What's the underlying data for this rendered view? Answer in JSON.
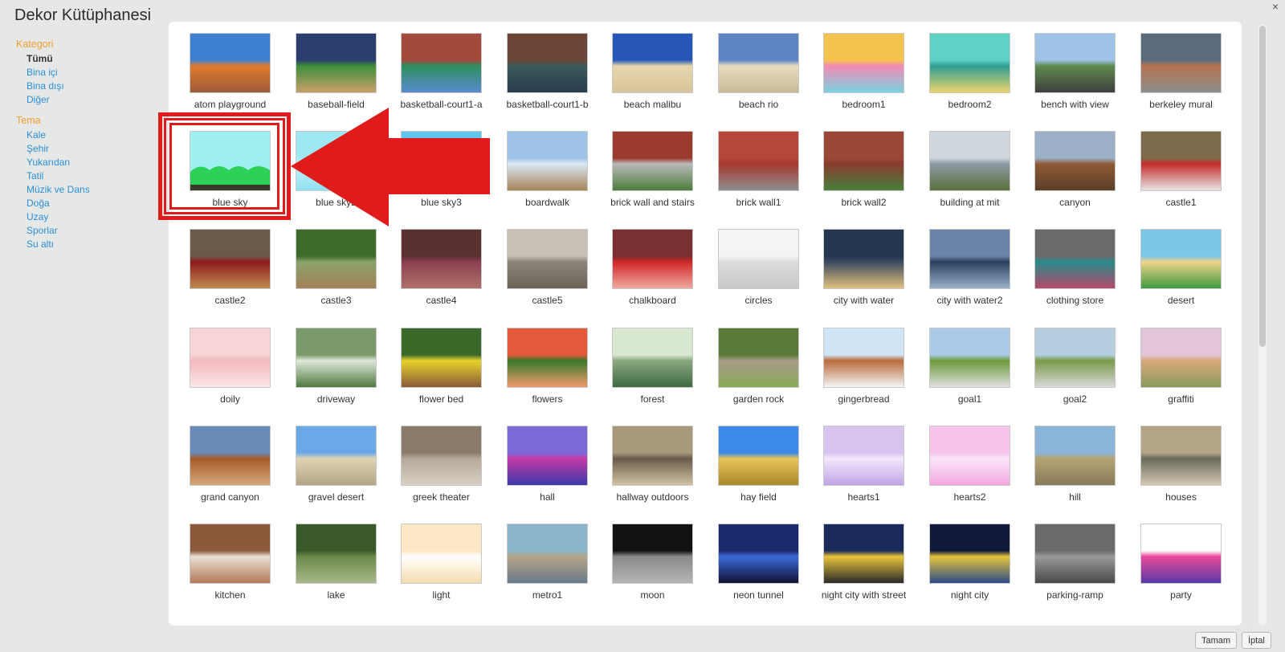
{
  "window": {
    "title": "Dekor Kütüphanesi",
    "close_glyph": "×"
  },
  "sidebar": {
    "category_title": "Kategori",
    "categories": [
      "Tümü",
      "Bina içi",
      "Bina dışı",
      "Diğer"
    ],
    "selected_category": "Tümü",
    "theme_title": "Tema",
    "themes": [
      "Kale",
      "Şehir",
      "Yukarıdan",
      "Tatil",
      "Müzik ve Dans",
      "Doğa",
      "Uzay",
      "Sporlar",
      "Su altı"
    ]
  },
  "backdrops": [
    "atom playground",
    "baseball-field",
    "basketball-court1-a",
    "basketball-court1-b",
    "beach malibu",
    "beach rio",
    "bedroom1",
    "bedroom2",
    "bench with view",
    "berkeley mural",
    "blue sky",
    "blue sky2",
    "blue sky3",
    "boardwalk",
    "brick wall and stairs",
    "brick wall1",
    "brick wall2",
    "building at mit",
    "canyon",
    "castle1",
    "castle2",
    "castle3",
    "castle4",
    "castle5",
    "chalkboard",
    "circles",
    "city with water",
    "city with water2",
    "clothing store",
    "desert",
    "doily",
    "driveway",
    "flower bed",
    "flowers",
    "forest",
    "garden rock",
    "gingerbread",
    "goal1",
    "goal2",
    "graffiti",
    "grand canyon",
    "gravel desert",
    "greek theater",
    "hall",
    "hallway outdoors",
    "hay field",
    "hearts1",
    "hearts2",
    "hill",
    "houses",
    "kitchen",
    "lake",
    "light",
    "metro1",
    "moon",
    "neon tunnel",
    "night city with street",
    "night city",
    "parking-ramp",
    "party"
  ],
  "buttons": {
    "ok": "Tamam",
    "cancel": "İptal"
  },
  "colors": {
    "accent_orange": "#f0a030",
    "link_blue": "#2a8fd6",
    "highlight_red": "#e01b1b"
  }
}
